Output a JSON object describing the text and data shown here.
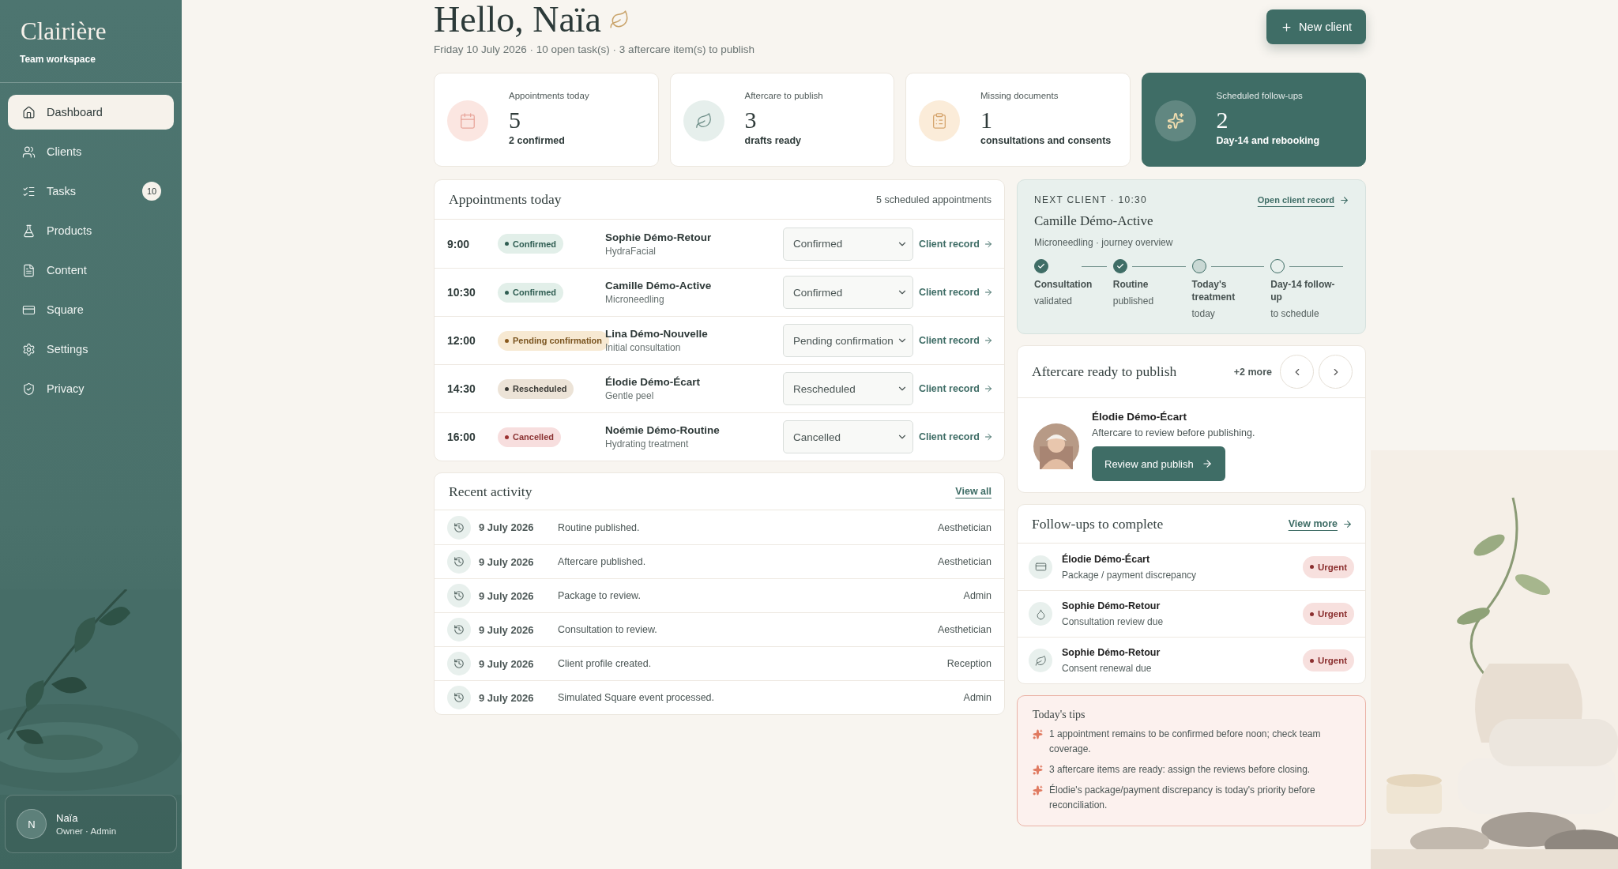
{
  "sidebar": {
    "logo": "Clairière",
    "workspace": "Team workspace",
    "items": [
      {
        "label": "Dashboard",
        "kind": "home",
        "selected": true
      },
      {
        "label": "Clients",
        "kind": "users",
        "selected": false
      },
      {
        "label": "Tasks",
        "kind": "tasks",
        "selected": false,
        "badge": "10"
      },
      {
        "label": "Products",
        "kind": "flask",
        "selected": false
      },
      {
        "label": "Content",
        "kind": "file",
        "selected": false
      },
      {
        "label": "Square",
        "kind": "card",
        "selected": false
      },
      {
        "label": "Settings",
        "kind": "settings",
        "selected": false
      },
      {
        "label": "Privacy",
        "kind": "shield",
        "selected": false
      }
    ],
    "user": {
      "initial": "N",
      "name": "Naïa",
      "role": "Owner · Admin"
    }
  },
  "header": {
    "title": "Hello, Naïa",
    "subtitle": "Friday 10 July 2026 · 10 open task(s) · 3 aftercare item(s) to publish",
    "new_button": "New client"
  },
  "stats": [
    {
      "label": "Appointments today",
      "value": "5",
      "sub": "2 confirmed",
      "kind": "calendar",
      "highlighted": false
    },
    {
      "label": "Aftercare to publish",
      "value": "3",
      "sub": "drafts ready",
      "kind": "leaf",
      "highlighted": false
    },
    {
      "label": "Missing documents",
      "value": "1",
      "sub": "consultations and consents",
      "kind": "clipboard",
      "highlighted": false
    },
    {
      "label": "Scheduled follow-ups",
      "value": "2",
      "sub": "Day-14 and rebooking",
      "kind": "sparkles",
      "highlighted": true
    }
  ],
  "appointments": {
    "title": "Appointments today",
    "count": "5 scheduled appointments",
    "rows": [
      {
        "time": "9:00",
        "status": "Confirmed",
        "kind": "confirmed",
        "name": "Sophie Démo-Retour",
        "service": "HydraFacial",
        "select": "Confirmed",
        "link": "Client record"
      },
      {
        "time": "10:30",
        "status": "Confirmed",
        "kind": "confirmed",
        "name": "Camille Démo-Active",
        "service": "Microneedling",
        "select": "Confirmed",
        "link": "Client record"
      },
      {
        "time": "12:00",
        "status": "Pending confirmation",
        "kind": "pending",
        "name": "Lina Démo-Nouvelle",
        "service": "Initial consultation",
        "select": "Pending confirmation",
        "link": "Client record"
      },
      {
        "time": "14:30",
        "status": "Rescheduled",
        "kind": "rescheduled",
        "name": "Élodie Démo-Écart",
        "service": "Gentle peel",
        "select": "Rescheduled",
        "link": "Client record"
      },
      {
        "time": "16:00",
        "status": "Cancelled",
        "kind": "cancelled",
        "name": "Noémie Démo-Routine",
        "service": "Hydrating treatment",
        "select": "Cancelled",
        "link": "Client record"
      }
    ]
  },
  "activity": {
    "title": "Recent activity",
    "link": "View all",
    "rows": [
      {
        "date": "9 July 2026",
        "event": "Routine published.",
        "role": "Aesthetician"
      },
      {
        "date": "9 July 2026",
        "event": "Aftercare published.",
        "role": "Aesthetician"
      },
      {
        "date": "9 July 2026",
        "event": "Package to review.",
        "role": "Admin"
      },
      {
        "date": "9 July 2026",
        "event": "Consultation to review.",
        "role": "Aesthetician"
      },
      {
        "date": "9 July 2026",
        "event": "Client profile created.",
        "role": "Reception"
      },
      {
        "date": "9 July 2026",
        "event": "Simulated Square event processed.",
        "role": "Admin"
      }
    ]
  },
  "next_client": {
    "eyebrow": "NEXT CLIENT · 10:30",
    "link": "Open client record",
    "name": "Camille Démo-Active",
    "detail": "Microneedling · journey overview",
    "steps": [
      {
        "title": "Consultation",
        "sub": "validated",
        "done": true,
        "current": false
      },
      {
        "title": "Routine",
        "sub": "published",
        "done": true,
        "current": false
      },
      {
        "title": "Today's treatment",
        "sub": "today",
        "done": false,
        "current": true
      },
      {
        "title": "Day-14 follow-up",
        "sub": "to schedule",
        "done": false,
        "current": false
      }
    ]
  },
  "aftercare": {
    "title": "Aftercare ready to publish",
    "more": "+2 more",
    "client": "Élodie Démo-Écart",
    "note": "Aftercare to review before publishing.",
    "button": "Review and publish"
  },
  "followups": {
    "title": "Follow-ups to complete",
    "link": "View more",
    "items": [
      {
        "name": "Élodie Démo-Écart",
        "detail": "Package / payment discrepancy",
        "kind": "card",
        "badge": "Urgent"
      },
      {
        "name": "Sophie Démo-Retour",
        "detail": "Consultation review due",
        "kind": "drop",
        "badge": "Urgent"
      },
      {
        "name": "Sophie Démo-Retour",
        "detail": "Consent renewal due",
        "kind": "leaf",
        "badge": "Urgent"
      }
    ]
  },
  "tips": {
    "title": "Today's tips",
    "items": [
      "1 appointment remains to be confirmed before noon; check team coverage.",
      "3 aftercare items are ready: assign the reviews before closing.",
      "Élodie's package/payment discrepancy is today's priority before reconciliation."
    ]
  }
}
